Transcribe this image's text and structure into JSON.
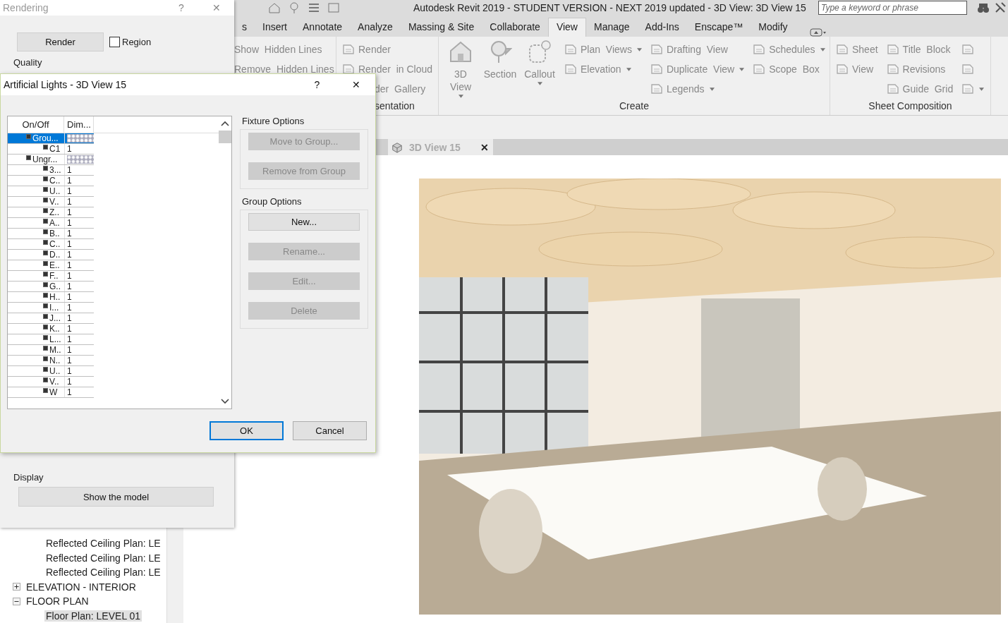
{
  "main": {
    "title": "Autodesk Revit 2019 - STUDENT VERSION - NEXT 2019 updated - 3D View: 3D View 15",
    "search": {
      "placeholder": "Type a keyword or phrase"
    },
    "tabs": [
      {
        "label": "s",
        "selected": false
      },
      {
        "label": "Insert",
        "selected": false
      },
      {
        "label": "Annotate",
        "selected": false
      },
      {
        "label": "Analyze",
        "selected": false
      },
      {
        "label": "Massing & Site",
        "selected": false
      },
      {
        "label": "Collaborate",
        "selected": false
      },
      {
        "label": "View",
        "selected": true
      },
      {
        "label": "Manage",
        "selected": false
      },
      {
        "label": "Add-Ins",
        "selected": false
      },
      {
        "label": "Enscape™",
        "selected": false
      },
      {
        "label": "Modify",
        "selected": false
      }
    ],
    "panels": [
      {
        "columns": [
          {
            "kind": "small",
            "items": [
              {
                "label": "Show  Hidden Lines",
                "icon": false,
                "dropdown": false
              },
              {
                "label": "Remove  Hidden Lines",
                "icon": false,
                "dropdown": false
              }
            ]
          }
        ]
      },
      {
        "label": "sentation",
        "columns": [
          {
            "kind": "small",
            "items": [
              {
                "label": "Render",
                "icon": true,
                "dropdown": false
              },
              {
                "label": "Render  in Cloud",
                "icon": true,
                "dropdown": false
              },
              {
                "label": "der  Gallery",
                "icon": false,
                "dropdown": false
              }
            ]
          }
        ]
      },
      {
        "label": "Create",
        "columns": [
          {
            "kind": "large",
            "items": [
              {
                "label": "3D View",
                "dropdown": true
              },
              {
                "label": "Section",
                "dropdown": false
              },
              {
                "label": "Callout",
                "dropdown": true
              }
            ]
          },
          {
            "kind": "small",
            "items": [
              {
                "label": "Plan  Views",
                "icon": true,
                "dropdown": true
              },
              {
                "label": "Elevation",
                "icon": true,
                "dropdown": true
              }
            ]
          },
          {
            "kind": "small",
            "items": [
              {
                "label": "Drafting  View",
                "icon": true,
                "dropdown": false
              },
              {
                "label": "Duplicate  View",
                "icon": true,
                "dropdown": true
              },
              {
                "label": "Legends",
                "icon": true,
                "dropdown": true
              }
            ]
          },
          {
            "kind": "small",
            "items": [
              {
                "label": "Schedules",
                "icon": true,
                "dropdown": true
              },
              {
                "label": "Scope  Box",
                "icon": true,
                "dropdown": false
              }
            ]
          }
        ]
      },
      {
        "label": "Sheet Composition",
        "columns": [
          {
            "kind": "small",
            "items": [
              {
                "label": "Sheet",
                "icon": true,
                "dropdown": false
              },
              {
                "label": "View",
                "icon": true,
                "dropdown": false
              }
            ]
          },
          {
            "kind": "small",
            "items": [
              {
                "label": "Title  Block",
                "icon": true,
                "dropdown": false
              },
              {
                "label": "Revisions",
                "icon": true,
                "dropdown": false
              },
              {
                "label": "Guide  Grid",
                "icon": true,
                "dropdown": false
              }
            ]
          },
          {
            "kind": "small",
            "items": [
              {
                "icon": true,
                "dropdown": false
              },
              {
                "icon": true,
                "dropdown": false
              },
              {
                "icon": true,
                "dropdown": true
              }
            ]
          }
        ]
      }
    ],
    "view_tab": {
      "label": "3D View 15",
      "selected": true,
      "close": "✕"
    },
    "browser": {
      "continued": [
        {
          "label": "Reflected Ceiling Plan: LE",
          "selected": false
        },
        {
          "label": "Reflected Ceiling Plan: LE",
          "selected": false
        },
        {
          "label": "Reflected Ceiling Plan: LE",
          "selected": false
        }
      ],
      "nodes": [
        {
          "label": "ELEVATION - INTERIOR",
          "expanded": false
        },
        {
          "label": "FLOOR PLAN",
          "expanded": true,
          "children": [
            {
              "label": "Floor Plan: LEVEL 01",
              "selected": true
            }
          ]
        }
      ]
    }
  },
  "rendering": {
    "title": "Rendering",
    "help": "?",
    "close": "✕",
    "render": "Render",
    "region": {
      "label": "Region",
      "checked": false
    },
    "quality": "Quality",
    "display": "Display",
    "show_model": "Show the model"
  },
  "lights": {
    "title": "Artificial Lights - 3D View 15",
    "help": "?",
    "close": "✕",
    "columns": [
      "On/Off",
      "Dim..."
    ],
    "tree": [
      {
        "name": "Grou...",
        "checked": true,
        "selected": true,
        "children": [
          {
            "name": "C1",
            "checked": true,
            "dim": "1"
          }
        ]
      },
      {
        "name": "Ungr...",
        "checked": true,
        "selected": false,
        "children": [
          {
            "name": "3...",
            "checked": true,
            "dim": "1"
          },
          {
            "name": "C..",
            "checked": true,
            "dim": "1"
          },
          {
            "name": "U..",
            "checked": true,
            "dim": "1"
          },
          {
            "name": "V..",
            "checked": true,
            "dim": "1"
          },
          {
            "name": "Z..",
            "checked": true,
            "dim": "1"
          },
          {
            "name": "A..",
            "checked": true,
            "dim": "1"
          },
          {
            "name": "B..",
            "checked": true,
            "dim": "1"
          },
          {
            "name": "C..",
            "checked": true,
            "dim": "1"
          },
          {
            "name": "D..",
            "checked": true,
            "dim": "1"
          },
          {
            "name": "E..",
            "checked": true,
            "dim": "1"
          },
          {
            "name": "F..",
            "checked": true,
            "dim": "1"
          },
          {
            "name": "G..",
            "checked": true,
            "dim": "1"
          },
          {
            "name": "H..",
            "checked": true,
            "dim": "1"
          },
          {
            "name": "I...",
            "checked": true,
            "dim": "1"
          },
          {
            "name": "J...",
            "checked": true,
            "dim": "1"
          },
          {
            "name": "K..",
            "checked": true,
            "dim": "1"
          },
          {
            "name": "L...",
            "checked": true,
            "dim": "1"
          },
          {
            "name": "M..",
            "checked": true,
            "dim": "1"
          },
          {
            "name": "N..",
            "checked": true,
            "dim": "1"
          },
          {
            "name": "U..",
            "checked": true,
            "dim": "1"
          },
          {
            "name": "V..",
            "checked": true,
            "dim": "1"
          },
          {
            "name": "W",
            "checked": true,
            "dim": "1"
          }
        ]
      }
    ],
    "groups": [
      {
        "title": "Fixture Options",
        "buttons": [
          {
            "label": "Move to Group...",
            "disabled": true
          },
          {
            "label": "Remove from Group",
            "disabled": true
          }
        ]
      },
      {
        "title": "Group Options",
        "buttons": [
          {
            "label": "New...",
            "disabled": false
          },
          {
            "label": "Rename...",
            "disabled": true
          },
          {
            "label": "Edit...",
            "disabled": true
          },
          {
            "label": "Delete",
            "disabled": true
          }
        ]
      }
    ],
    "footer": [
      {
        "label": "OK",
        "default": true
      },
      {
        "label": "Cancel",
        "default": false
      }
    ]
  }
}
